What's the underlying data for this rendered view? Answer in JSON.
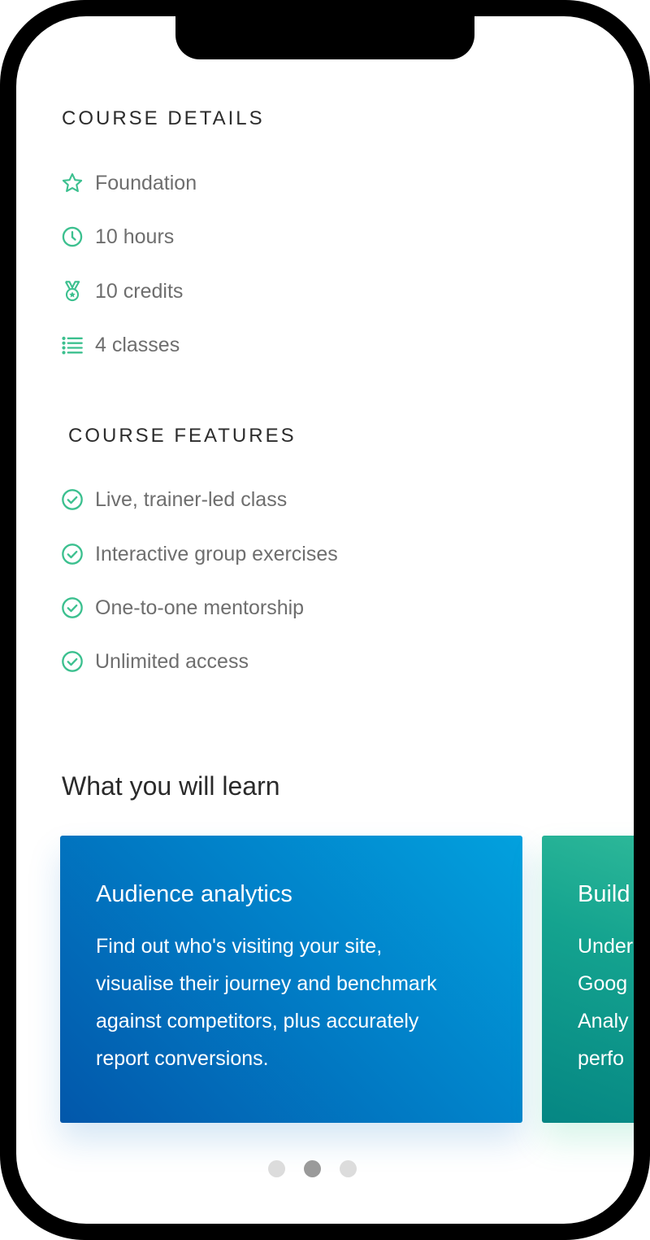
{
  "course_details": {
    "heading": "COURSE DETAILS",
    "items": [
      {
        "icon": "star-icon",
        "label": "Foundation"
      },
      {
        "icon": "clock-icon",
        "label": "10 hours"
      },
      {
        "icon": "medal-icon",
        "label": "10 credits"
      },
      {
        "icon": "list-icon",
        "label": "4 classes"
      }
    ]
  },
  "course_features": {
    "heading": "COURSE FEATURES",
    "items": [
      {
        "icon": "check-circle-icon",
        "label": "Live, trainer-led class"
      },
      {
        "icon": "check-circle-icon",
        "label": "Interactive group exercises"
      },
      {
        "icon": "check-circle-icon",
        "label": "One-to-one mentorship"
      },
      {
        "icon": "check-circle-icon",
        "label": "Unlimited access"
      }
    ]
  },
  "learn": {
    "heading": "What you will learn",
    "cards": [
      {
        "title": "Audience analytics",
        "text": "Find out who's visiting your site,\nvisualise their journey and benchmark\nagainst competitors, plus accurately\nreport conversions."
      },
      {
        "title": "Build",
        "text": "Under\nGoog\nAnaly\nperfo"
      }
    ]
  },
  "carousel": {
    "dots": 3,
    "active_index": 1
  },
  "colors": {
    "accent_green": "#3cc08f",
    "card_blue": "#0180c8",
    "card_green": "#14a38f"
  }
}
